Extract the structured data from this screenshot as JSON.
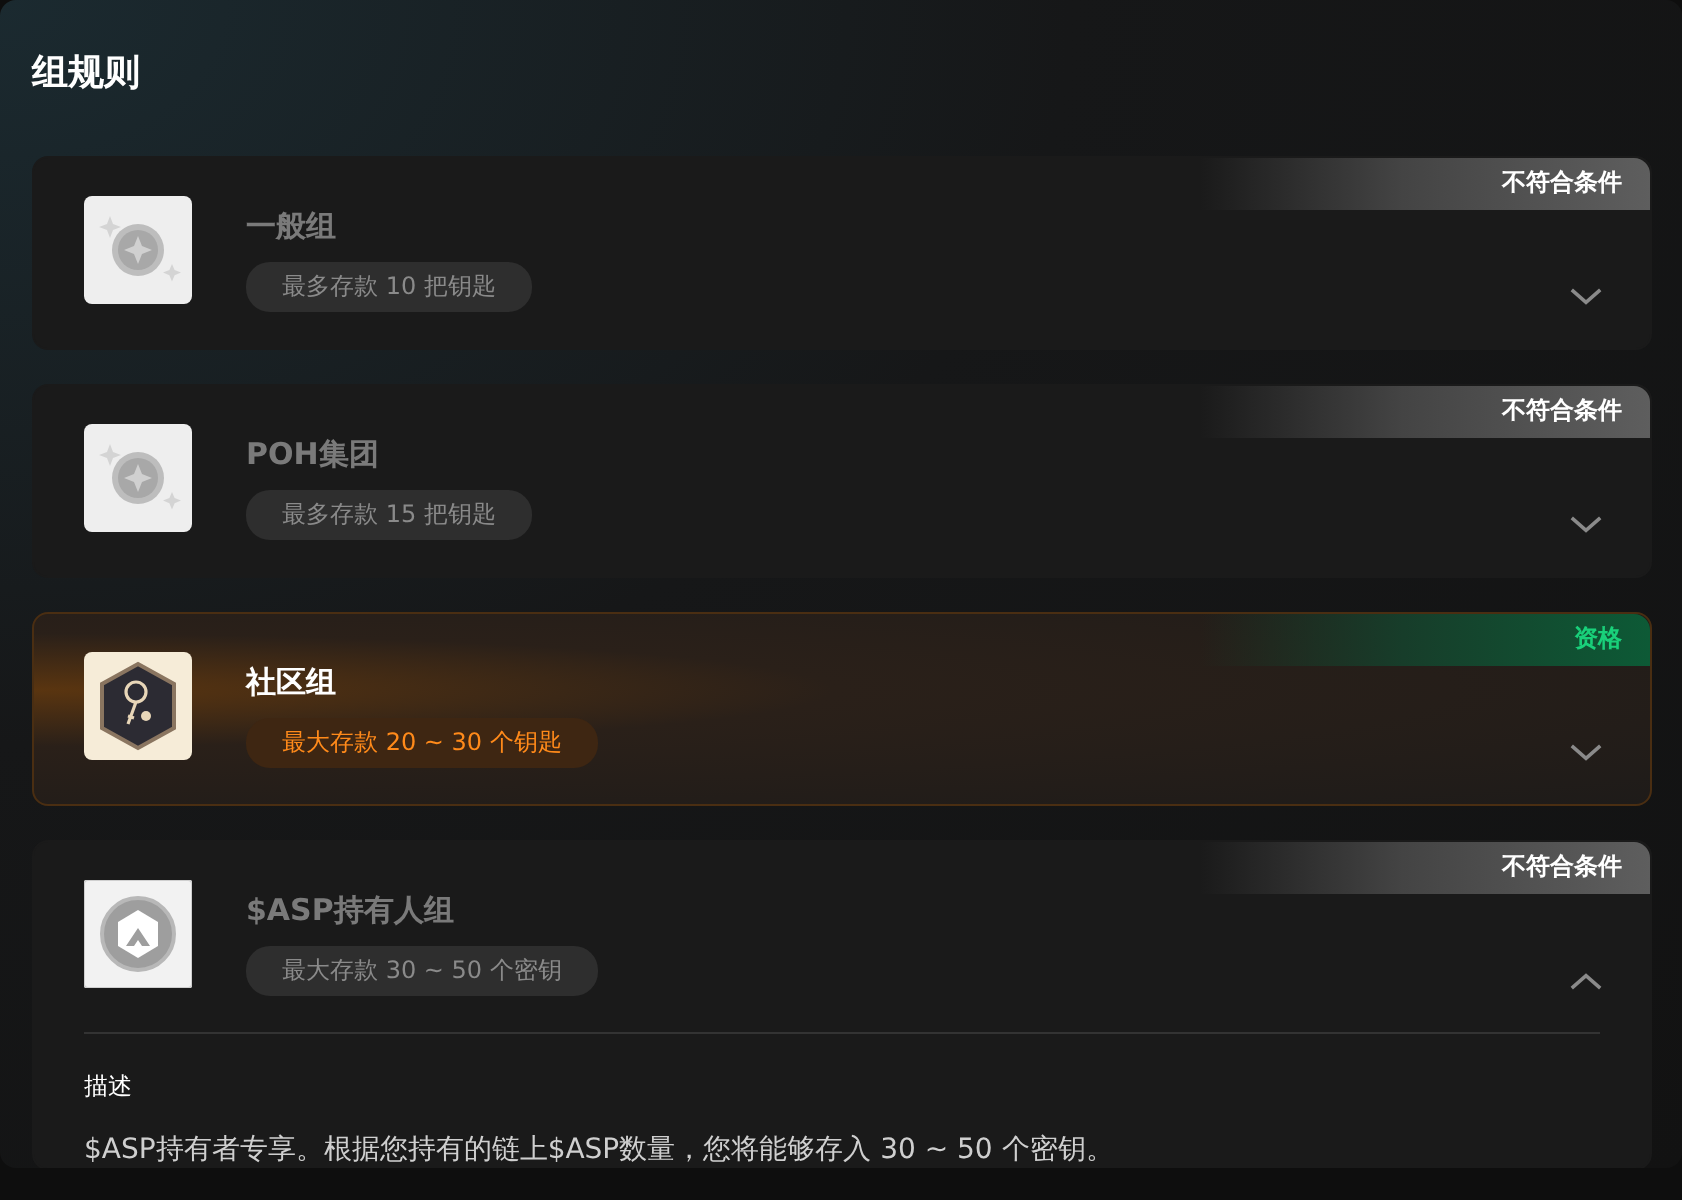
{
  "title": "组规则",
  "groups": [
    {
      "name": "一般组",
      "capacity": "最多存款 10 把钥匙",
      "status": "不符合条件",
      "eligible": false,
      "expanded": false,
      "kind": "coin"
    },
    {
      "name": "POH集团",
      "capacity": "最多存款 15 把钥匙",
      "status": "不符合条件",
      "eligible": false,
      "expanded": false,
      "kind": "coin"
    },
    {
      "name": "社区组",
      "capacity": "最大存款 20 ~ 30 个钥匙",
      "status": "资格",
      "eligible": true,
      "expanded": false,
      "kind": "keys"
    },
    {
      "name": "$ASP持有人组",
      "capacity": "最大存款 30 ~ 50 个密钥",
      "status": "不符合条件",
      "eligible": false,
      "expanded": true,
      "kind": "asp",
      "description_label": "描述",
      "description": "$ASP持有者专享。根据您持有的链上$ASP数量，您将能够存入 30 ~ 50 个密钥。"
    }
  ]
}
